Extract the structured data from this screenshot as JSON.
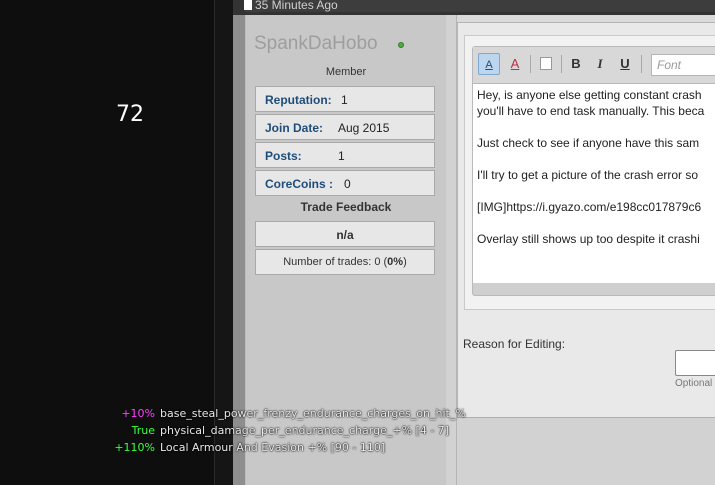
{
  "left_panel": {
    "number": "72"
  },
  "header": {
    "timestamp": "35 Minutes Ago"
  },
  "user": {
    "name": "SpankDaHobo",
    "rank": "Member",
    "stats": [
      {
        "label": "Reputation:",
        "value": "1"
      },
      {
        "label": "Join Date:",
        "value": "Aug 2015"
      },
      {
        "label": "Posts:",
        "value": "1"
      },
      {
        "label": "CoreCoins :",
        "value": "0"
      }
    ],
    "trade_feedback_title": "Trade Feedback",
    "trade_rating": "n/a",
    "trade_count_prefix": "Number of trades: 0 (",
    "trade_count_percent": "0%",
    "trade_count_suffix": ")"
  },
  "editor": {
    "font_placeholder": "Font",
    "lines": [
      "Hey, is anyone else getting constant crash",
      "you'll have to end task manually. This beca",
      "Just check to see if anyone have this sam",
      "I'll try to get a picture of the crash error so",
      "[IMG]https://i.gyazo.com/e198cc017879c6",
      "Overlay still shows up too despite it crashi"
    ]
  },
  "edit_reason": {
    "label": "Reason for Editing:",
    "optional": "Optional"
  },
  "overlay": [
    {
      "prefix": "+10%",
      "prefix_color": "#ff3cff",
      "text": "base_steal_power_frenzy_endurance_charges_on_hit_%"
    },
    {
      "prefix": "True",
      "prefix_color": "#3cff3c",
      "text": "physical_damage_per_endurance_charge_+% [4 - 7]"
    },
    {
      "prefix": "+110%",
      "prefix_color": "#3cff3c",
      "text": "Local Armour And Evasion +% [90 - 110]"
    }
  ],
  "colors": {
    "username": "#9e9e9e",
    "label_blue": "#1f4d7a",
    "online": "#4caf3d"
  }
}
